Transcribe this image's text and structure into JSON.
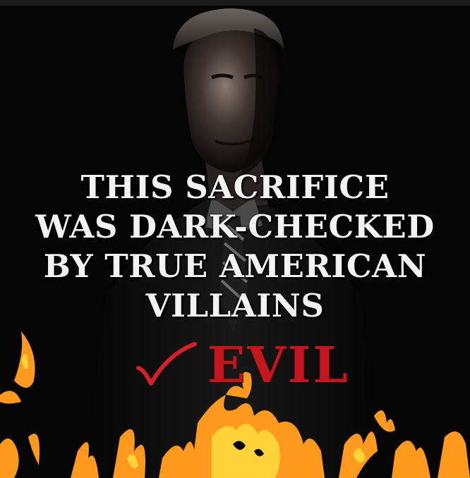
{
  "meme": {
    "headline_lines": [
      "THIS SACRIFICE",
      "WAS DARK-CHECKED",
      "BY TRUE AMERICAN",
      "VILLAINS"
    ],
    "evil_label": "EVIL",
    "check_icon": "check-mark-icon",
    "colors": {
      "background": "#050505",
      "text": "#f2f2f2",
      "evil": "#c4161c",
      "check": "#d4202a",
      "flame_outer": "#ff9a1f",
      "flame_inner": "#ffd23a"
    }
  }
}
